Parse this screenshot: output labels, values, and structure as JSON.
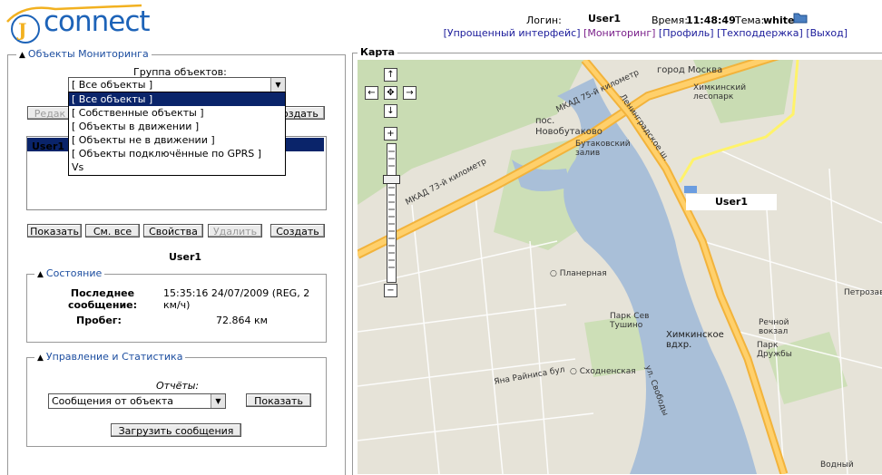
{
  "header": {
    "login_label": "Логин:",
    "login_value": "User1",
    "time_label": "Время:",
    "time_value": "11:48:49",
    "theme_label": "Тема:",
    "theme_value": "white",
    "links": [
      {
        "label": "[Упрощенный интерфейс]",
        "active": false
      },
      {
        "label": "[Мониторинг]",
        "active": true
      },
      {
        "label": "[Профиль]",
        "active": false
      },
      {
        "label": "[Техподдержка]",
        "active": false
      },
      {
        "label": "[Выход]",
        "active": false
      }
    ]
  },
  "logo": {
    "text": "connect"
  },
  "objects_panel": {
    "legend": "Объекты Мониторинга",
    "group_label": "Группа объектов:",
    "group_selected": "[ Все объекты ]",
    "group_options": [
      "[ Все объекты ]",
      "[ Собственные объекты ]",
      "[ Объекты в движении ]",
      "[ Объекты не в движении ]",
      "[ Объекты подключённые по GPRS ]",
      "Vs"
    ],
    "top_buttons": {
      "edit": "Редак",
      "create": "оздать"
    },
    "list_items": [
      "User1"
    ],
    "buttons": {
      "show": "Показать",
      "show_all": "См. все",
      "props": "Свойства",
      "delete": "Удалить",
      "create": "Создать"
    },
    "selected_object": "User1"
  },
  "status_panel": {
    "legend": "Состояние",
    "last_msg_label": "Последнее сообщение:",
    "last_msg_value": "15:35:16 24/07/2009 (REG, 2 км/ч)",
    "mileage_label": "Пробег:",
    "mileage_value": "72.864 км"
  },
  "control_panel": {
    "legend": "Управление и Статистика",
    "reports_label": "Отчёты:",
    "report_selected": "Сообщения от объекта",
    "show_button": "Показать",
    "load_button": "Загрузить сообщения"
  },
  "map": {
    "legend": "Карта",
    "marker_label": "User1",
    "labels": {
      "moscow": "город Москва",
      "mkad75": "МКАД 75-й километр",
      "mkad73": "МКАД 73-й километр",
      "novobutakovo": "пос. Новобутаково",
      "butakovsky": "Бутаковский залив",
      "khimki_park": "Химкинский лесопарк",
      "leningrad": "Ленинградское ш.",
      "planernaya": "Планерная",
      "park_sev": "Парк Сев Тушино",
      "khimki_res": "Химкинское вдхр.",
      "rechnoy": "Речной вокзал",
      "park_druzhby": "Парк Дружбы",
      "skhodnenskaya": "Сходненская",
      "raynis": "Яна Райниса бул",
      "svobody": "ул. Свободы",
      "petrozavod": "Петрозаводск",
      "vodny": "Водный"
    }
  }
}
